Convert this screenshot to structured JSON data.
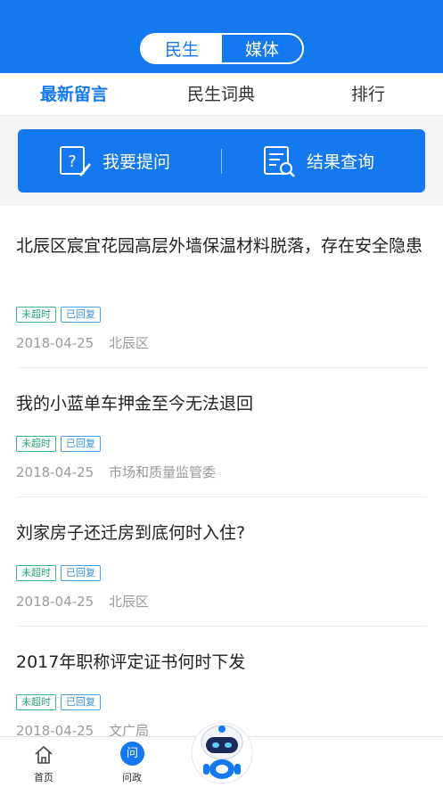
{
  "segment": {
    "left": "民生",
    "right": "媒体"
  },
  "tabs": [
    {
      "label": "最新留言"
    },
    {
      "label": "民生词典"
    },
    {
      "label": "排行"
    }
  ],
  "actions": {
    "ask": {
      "label": "我要提问",
      "icon": "question-document-icon"
    },
    "result": {
      "label": "结果查询",
      "icon": "search-document-icon"
    }
  },
  "items": [
    {
      "title": "北辰区宸宜花园高层外墙保温材料脱落，存在安全隐患",
      "tag1": "未超时",
      "tag2": "已回复",
      "date": "2018-04-25",
      "dept": "北辰区"
    },
    {
      "title": "我的小蓝单车押金至今无法退回",
      "tag1": "未超时",
      "tag2": "已回复",
      "date": "2018-04-25",
      "dept": "市场和质量监管委"
    },
    {
      "title": "刘家房子还迁房到底何时入住?",
      "tag1": "未超时",
      "tag2": "已回复",
      "date": "2018-04-25",
      "dept": "北辰区"
    },
    {
      "title": "2017年职称评定证书何时下发",
      "tag1": "未超时",
      "tag2": "已回复",
      "date": "2018-04-25",
      "dept": "文广局"
    }
  ],
  "bottom_nav": {
    "home": {
      "label": "首页",
      "icon": "home-icon"
    },
    "ask": {
      "label": "问政",
      "badge": "问"
    },
    "robot": {
      "icon": "robot-assistant-icon"
    }
  },
  "colors": {
    "primary": "#1478f0",
    "tag_green": "#2aa574",
    "tag_blue": "#3a8fd8"
  }
}
